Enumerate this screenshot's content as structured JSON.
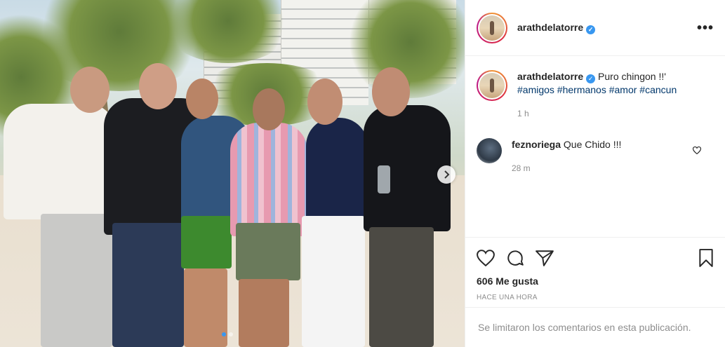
{
  "post": {
    "author": "arathdelatorre",
    "caption": "Puro chingon !!'",
    "hashtags": "#amigos #hermanos #amor #cancun",
    "caption_time": "1 h",
    "comments": [
      {
        "user": "feznoriega",
        "text": "Que Chido !!!",
        "time": "28 m"
      }
    ],
    "likes": "606 Me gusta",
    "posted": "HACE UNA HORA",
    "comments_limited": "Se limitaron los comentarios en esta publicación."
  },
  "carousel": {
    "slides": 2,
    "active_index": 0
  },
  "icons": {
    "verified": "verified-badge-icon",
    "more": "more-options-icon",
    "like": "heart-icon",
    "comment": "comment-bubble-icon",
    "share": "paper-plane-icon",
    "save": "bookmark-icon",
    "next": "chevron-right-icon"
  },
  "colors": {
    "verified": "#3897f0",
    "hashtag": "#00376b",
    "muted": "#8e8e8e",
    "text": "#262626"
  }
}
